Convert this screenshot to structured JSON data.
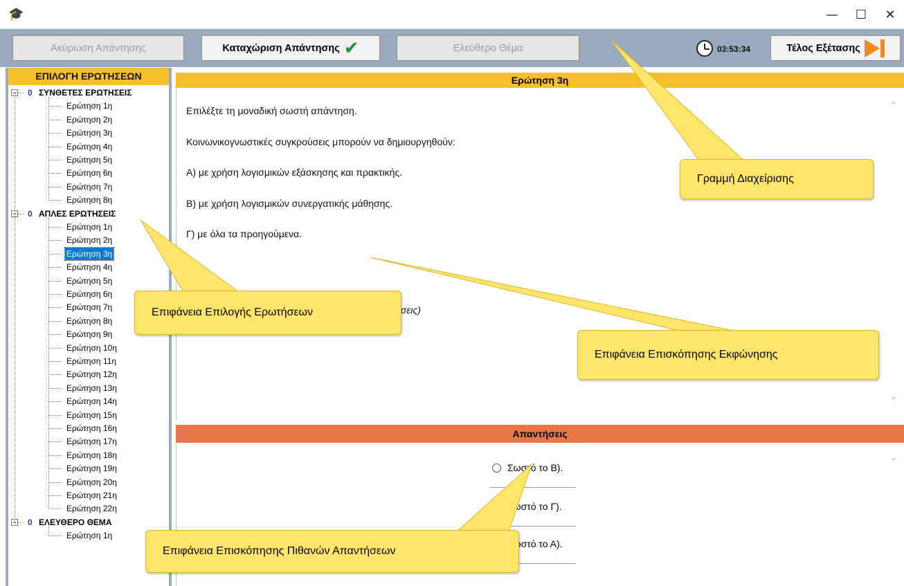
{
  "window": {
    "app_icon": "graduation-cap-icon",
    "minimize_glyph": "—",
    "maximize_glyph": "☐",
    "close_glyph": "✕"
  },
  "toolbar": {
    "cancel_label": "Ακύρωση Απάντησης",
    "submit_label": "Καταχώριση Απάντησης",
    "free_topic_label": "Ελεύθερο Θέμα",
    "timer": "03:53:34",
    "end_exam_label": "Τέλος Εξέτασης"
  },
  "tree": {
    "header": "ΕΠΙΛΟΓΗ ΕΡΩΤΗΣΕΩΝ",
    "categories": [
      {
        "count": "0",
        "label": "ΣΥΝΘΕΤΕΣ ΕΡΩΤΗΣΕΙΣ",
        "items": [
          "Ερώτηση 1η",
          "Ερώτηση 2η",
          "Ερώτηση 3η",
          "Ερώτηση 4η",
          "Ερώτηση 5η",
          "Ερώτηση 6η",
          "Ερώτηση 7η",
          "Ερώτηση 8η"
        ]
      },
      {
        "count": "0",
        "label": "ΑΠΛΕΣ ΕΡΩΤΗΣΕΙΣ",
        "items": [
          "Ερώτηση 1η",
          "Ερώτηση 2η",
          "Ερώτηση 3η",
          "Ερώτηση 4η",
          "Ερώτηση 5η",
          "Ερώτηση 6η",
          "Ερώτηση 7η",
          "Ερώτηση 8η",
          "Ερώτηση 9η",
          "Ερώτηση 10η",
          "Ερώτηση 11η",
          "Ερώτηση 12η",
          "Ερώτηση 13η",
          "Ερώτηση 14η",
          "Ερώτηση 15η",
          "Ερώτηση 16η",
          "Ερώτηση 17η",
          "Ερώτηση 18η",
          "Ερώτηση 19η",
          "Ερώτηση 20η",
          "Ερώτηση 21η",
          "Ερώτηση 22η"
        ]
      },
      {
        "count": "0",
        "label": "ΕΛΕΥΘΕΡΟ ΘΕΜΑ",
        "items": [
          "Ερώτηση 1η"
        ]
      }
    ],
    "selected": {
      "category": 1,
      "item": 2
    }
  },
  "question": {
    "header": "Ερώτηση 3η",
    "lines": [
      "Επιλέξτε τη μοναδική σωστή απάντηση.",
      "Κοινωνικογνωστικές συγκρούσεις μπορούν να δημιουργηθούν:",
      "Α) με χρήση λογισμικών εξάσκησης και πρακτικής.",
      "Β) με χρήση λογισμικών συνεργατικής μάθησης.",
      "Γ) με όλα τα προηγούμενα."
    ],
    "note_fragment": "ήσεις)"
  },
  "answers": {
    "header": "Απαντήσεις",
    "options": [
      "Σωστό το Β).",
      "Σωστό το Γ).",
      "Σωστό το Α)."
    ]
  },
  "callouts": {
    "admin_bar": "Γραμμή Διαχείρισης",
    "question_selection": "Επιφάνεια Επιλογής Ερωτήσεων",
    "statement_preview": "Επιφάνεια Επισκόπησης Εκφώνησης",
    "answers_preview": "Επιφάνεια Επισκόπησης Πιθανών Απαντήσεων"
  },
  "colors": {
    "toolbar_bg": "#9aabbd",
    "header_yellow": "#f7c02a",
    "header_orange": "#e8784a",
    "callout_bg": "#ffe56a",
    "selected_bg": "#0a78d7"
  }
}
